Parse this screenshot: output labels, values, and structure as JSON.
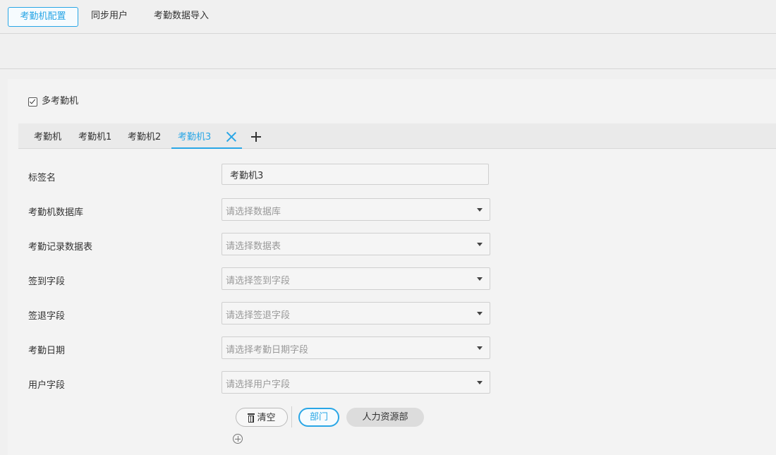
{
  "topnav": {
    "tabs": [
      {
        "label": "考勤机配置",
        "active": true
      },
      {
        "label": "同步用户",
        "active": false
      },
      {
        "label": "考勤数据导入",
        "active": false
      }
    ]
  },
  "multi_device": {
    "label": "多考勤机",
    "checked": true
  },
  "device_tabs": [
    {
      "label": "考勤机"
    },
    {
      "label": "考勤机1"
    },
    {
      "label": "考勤机2"
    },
    {
      "label": "考勤机3",
      "active": true,
      "icon": "close-icon"
    }
  ],
  "add_tab_icon": "plus-icon",
  "form": {
    "tag_name": {
      "label": "标签名",
      "value": "考勤机3"
    },
    "database": {
      "label": "考勤机数据库",
      "placeholder": "请选择数据库"
    },
    "table": {
      "label": "考勤记录数据表",
      "placeholder": "请选择数据表"
    },
    "checkin": {
      "label": "签到字段",
      "placeholder": "请选择签到字段"
    },
    "checkout": {
      "label": "签退字段",
      "placeholder": "请选择签退字段"
    },
    "date": {
      "label": "考勤日期",
      "placeholder": "请选择考勤日期字段"
    },
    "user": {
      "label": "用户字段",
      "placeholder": "请选择用户字段"
    }
  },
  "filter": {
    "clear_label": "清空",
    "clear_icon": "trash-icon",
    "dept_label": "部门",
    "hr_label": "人力资源部",
    "add_icon": "add-circle-icon"
  },
  "colors": {
    "accent": "#29a6e6",
    "panel": "#f3f3f3",
    "background": "#f0f0f0"
  }
}
